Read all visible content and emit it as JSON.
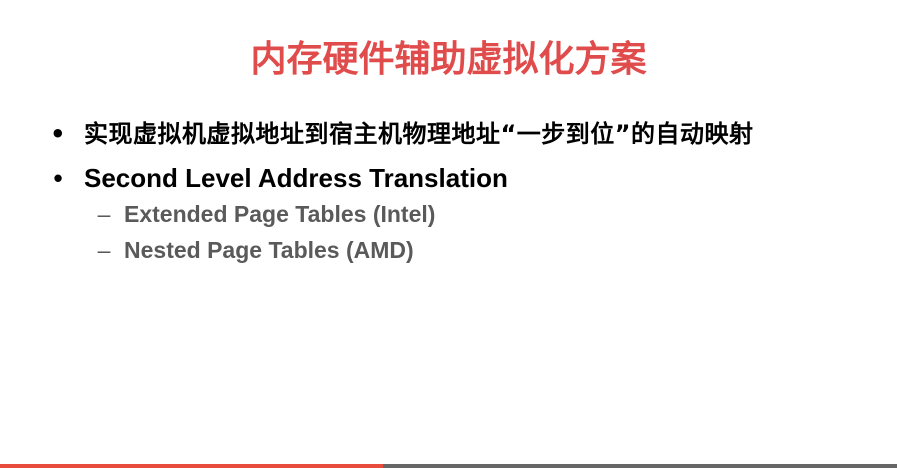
{
  "slide": {
    "title": "内存硬件辅助虚拟化方案",
    "bullet_marker": "•",
    "sub_marker": "–",
    "bullets": [
      {
        "text": "实现虚拟机虚拟地址到宿主机物理地址“一步到位”的自动映射"
      },
      {
        "text": "Second Level Address Translation",
        "subitems": [
          {
            "text": "Extended Page Tables (Intel)"
          },
          {
            "text": "Nested Page Tables (AMD)"
          }
        ]
      }
    ]
  },
  "colors": {
    "title": "#e04c4c",
    "bullet_text": "#000000",
    "sub_text": "#5a5a5a",
    "bottom_bar_left": "#e84c3d",
    "bottom_bar_right": "#666666",
    "background": "#ffffff"
  }
}
